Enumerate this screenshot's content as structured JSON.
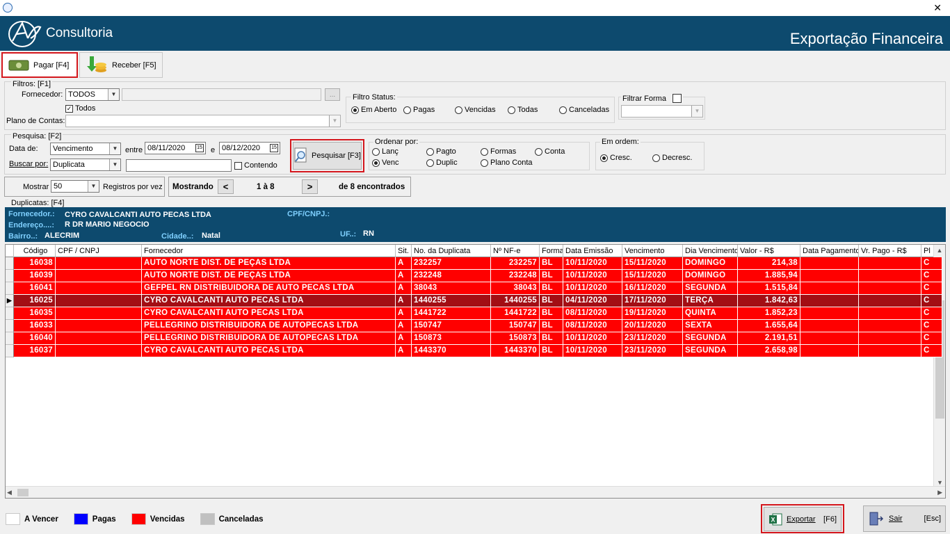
{
  "window": {
    "close_glyph": "✕"
  },
  "header": {
    "brand": "Consultoria",
    "page_title": "Exportação Financeira"
  },
  "tabs": [
    {
      "label": "Pagar [F4]",
      "selected": true
    },
    {
      "label": "Receber [F5]",
      "selected": false
    }
  ],
  "filters": {
    "group_label": "Filtros: [F1]",
    "fornecedor_label": "Fornecedor:",
    "fornecedor_value": "TODOS",
    "todos_label": "Todos",
    "todos_checked": true,
    "plano_label": "Plano de Contas:",
    "browse_label": "...",
    "status_group": "Filtro Status:",
    "status_options": [
      "Em Aberto",
      "Pagas",
      "Vencidas",
      "Todas",
      "Canceladas"
    ],
    "status_selected": "Em Aberto",
    "forma_label": "Filtrar Forma"
  },
  "search": {
    "group_label": "Pesquisa: [F2]",
    "data_de_label": "Data de:",
    "data_de_value": "Vencimento",
    "entre_label": "entre",
    "date_from": "08/11/2020",
    "e_label": "e",
    "date_to": "08/12/2020",
    "buscar_label": "Buscar por:",
    "buscar_value": "Duplicata",
    "contendo_label": "Contendo",
    "search_button": "Pesquisar [F3]",
    "order_group": "Ordenar por:",
    "order_options": [
      "Lanç",
      "Pagto",
      "Formas",
      "Conta",
      "Venc",
      "Duplic",
      "Plano Conta"
    ],
    "order_selected": "Venc",
    "sort_group": "Em ordem:",
    "sort_options": [
      "Cresc.",
      "Decresc."
    ],
    "sort_selected": "Cresc."
  },
  "paging": {
    "mostrar_label": "Mostrar",
    "page_size": "50",
    "per_page_label": "Registros por vez",
    "showing_label": "Mostrando",
    "prev": "<",
    "range": "1 à 8",
    "next": ">",
    "found": "de 8 encontrados"
  },
  "duplicatas": {
    "group_label": "Duplicatas: [F4]",
    "fornecedor_key": "Fornecedor.:",
    "fornecedor_val": "CYRO CAVALCANTI AUTO PECAS LTDA",
    "cpf_key": "CPF/CNPJ.:",
    "cpf_val": "",
    "endereco_key": "Endereço....:",
    "endereco_val": "R DR MARIO NEGOCIO",
    "bairro_key": "Bairro..:",
    "bairro_val": "ALECRIM",
    "cidade_key": "Cidade..:",
    "cidade_val": "Natal",
    "uf_key": "UF..:",
    "uf_val": "RN"
  },
  "table": {
    "columns": [
      "Código",
      "CPF / CNPJ",
      "Fornecedor",
      "Sit.",
      "No. da Duplicata",
      "Nº NF-e",
      "Forma",
      "Data Emissão",
      "Vencimento",
      "Dia Vencimento",
      "Valor - R$",
      "Data Pagamento",
      "Vr. Pago - R$",
      "Pl"
    ],
    "rows": [
      [
        "16038",
        "",
        "AUTO NORTE DIST. DE PEÇAS LTDA",
        "A",
        "232257",
        "232257",
        "BL",
        "10/11/2020",
        "15/11/2020",
        "DOMINGO",
        "214,38",
        "",
        "",
        "C"
      ],
      [
        "16039",
        "",
        "AUTO NORTE DIST. DE PEÇAS LTDA",
        "A",
        "232248",
        "232248",
        "BL",
        "10/11/2020",
        "15/11/2020",
        "DOMINGO",
        "1.885,94",
        "",
        "",
        "C"
      ],
      [
        "16041",
        "",
        "GEFPEL RN DISTRIBUIDORA DE AUTO PECAS LTDA",
        "A",
        "38043",
        "38043",
        "BL",
        "10/11/2020",
        "16/11/2020",
        "SEGUNDA",
        "1.515,84",
        "",
        "",
        "C"
      ],
      [
        "16025",
        "",
        "CYRO CAVALCANTI AUTO PECAS LTDA",
        "A",
        "1440255",
        "1440255",
        "BL",
        "04/11/2020",
        "17/11/2020",
        "TERÇA",
        "1.842,63",
        "",
        "",
        "C"
      ],
      [
        "16035",
        "",
        "CYRO CAVALCANTI AUTO PECAS LTDA",
        "A",
        "1441722",
        "1441722",
        "BL",
        "08/11/2020",
        "19/11/2020",
        "QUINTA",
        "1.852,23",
        "",
        "",
        "C"
      ],
      [
        "16033",
        "",
        "PELLEGRINO DISTRIBUIDORA DE AUTOPECAS LTDA",
        "A",
        "150747",
        "150747",
        "BL",
        "08/11/2020",
        "20/11/2020",
        "SEXTA",
        "1.655,64",
        "",
        "",
        "C"
      ],
      [
        "16040",
        "",
        "PELLEGRINO DISTRIBUIDORA DE AUTOPECAS LTDA",
        "A",
        "150873",
        "150873",
        "BL",
        "10/11/2020",
        "23/11/2020",
        "SEGUNDA",
        "2.191,51",
        "",
        "",
        "C"
      ],
      [
        "16037",
        "",
        "CYRO CAVALCANTI AUTO PECAS LTDA",
        "A",
        "1443370",
        "1443370",
        "BL",
        "10/11/2020",
        "23/11/2020",
        "SEGUNDA",
        "2.658,98",
        "",
        "",
        "C"
      ]
    ],
    "selected_row": 3
  },
  "legend": [
    {
      "label": "A Vencer",
      "color": "#ffffff"
    },
    {
      "label": "Pagas",
      "color": "#0000ff"
    },
    {
      "label": "Vencidas",
      "color": "#ff0000"
    },
    {
      "label": "Canceladas",
      "color": "#c0c0c0"
    }
  ],
  "actions": {
    "export_label": "Exportar",
    "export_key": "[F6]",
    "exit_label": "Sair",
    "exit_key": "[Esc]"
  },
  "colors": {
    "header_bg": "#0d4a6e",
    "row_red": "#ff0000",
    "row_selected": "#a30e14",
    "highlight_border": "#d4161c"
  }
}
